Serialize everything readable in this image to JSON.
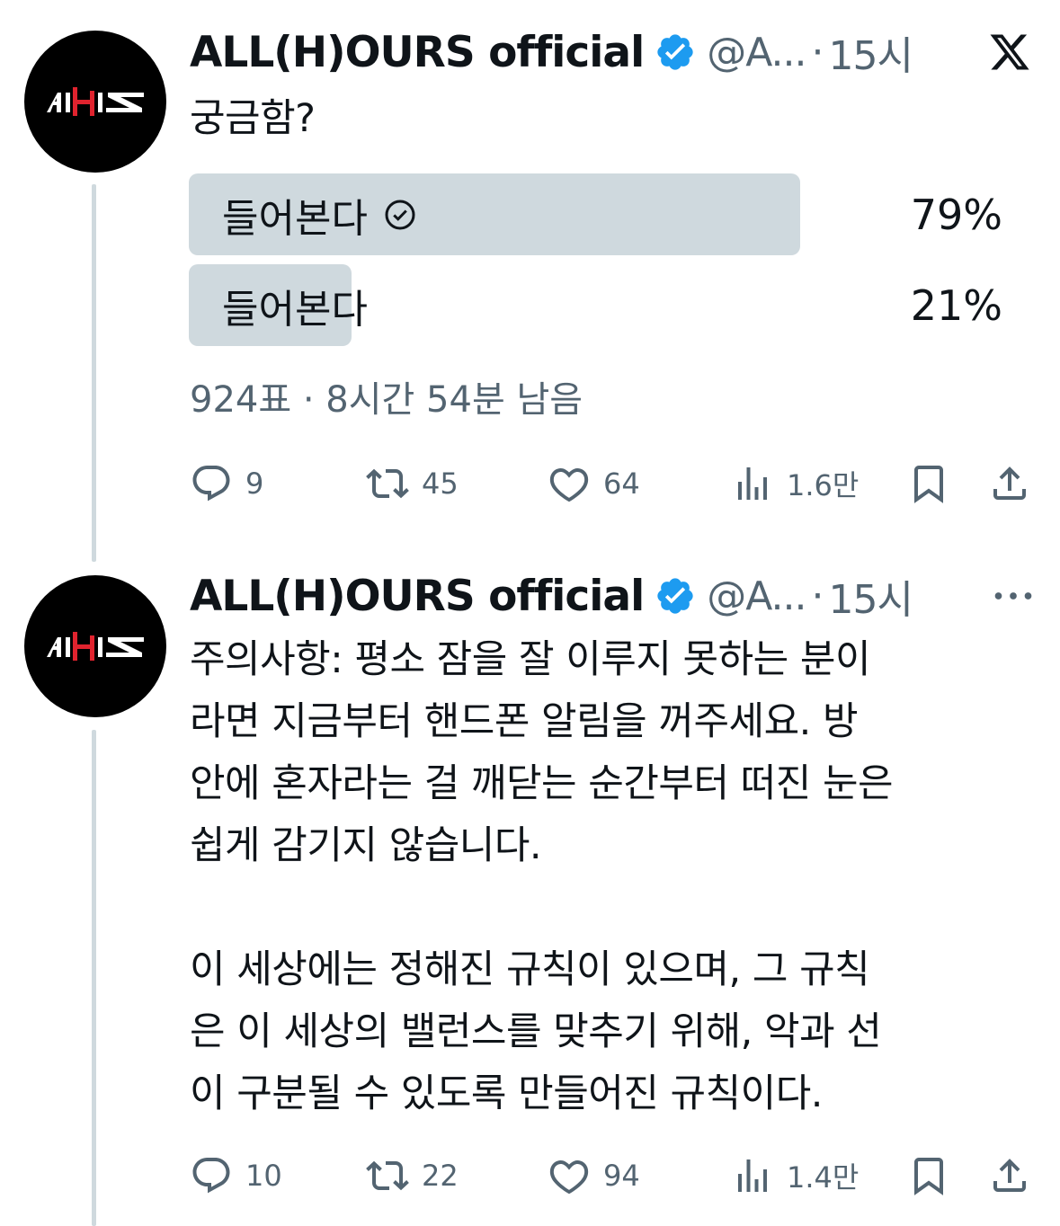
{
  "tweets": [
    {
      "author": {
        "name": "ALL(H)OURS official",
        "handle": "@A...",
        "avatar_icon": "allhours-logo"
      },
      "separator": "·",
      "time": "15시",
      "text": "궁금함?",
      "poll": {
        "options": [
          {
            "label": "들어본다",
            "percent": "79%",
            "share": 0.79,
            "selected": true
          },
          {
            "label": "들어본다",
            "percent": "21%",
            "share": 0.21,
            "selected": false
          }
        ],
        "meta": "924표 · 8시간 54분 남음"
      },
      "stats": {
        "replies": "9",
        "retweets": "45",
        "likes": "64",
        "views": "1.6만"
      }
    },
    {
      "author": {
        "name": "ALL(H)OURS official",
        "handle": "@A...",
        "avatar_icon": "allhours-logo"
      },
      "separator": "·",
      "time": "15시",
      "text": "주의사항: 평소 잠을 잘 이루지 못하는 분이\n라면 지금부터 핸드폰 알림을 꺼주세요. 방\n안에 혼자라는 걸 깨닫는 순간부터 떠진 눈은\n쉽게 감기지 않습니다.\n\n이 세상에는 정해진 규칙이 있으며, 그 규칙\n은 이 세상의 밸런스를 맞추기 위해, 악과 선\n이 구분될 수 있도록 만들어진 규칙이다.",
      "stats": {
        "replies": "10",
        "retweets": "22",
        "likes": "94",
        "views": "1.4만"
      }
    }
  ],
  "colors": {
    "text": "#0f1419",
    "muted": "#536471",
    "poll_bar": "#cfd9de",
    "verified": "#1d9bf0",
    "logo_red": "#e0232e"
  }
}
